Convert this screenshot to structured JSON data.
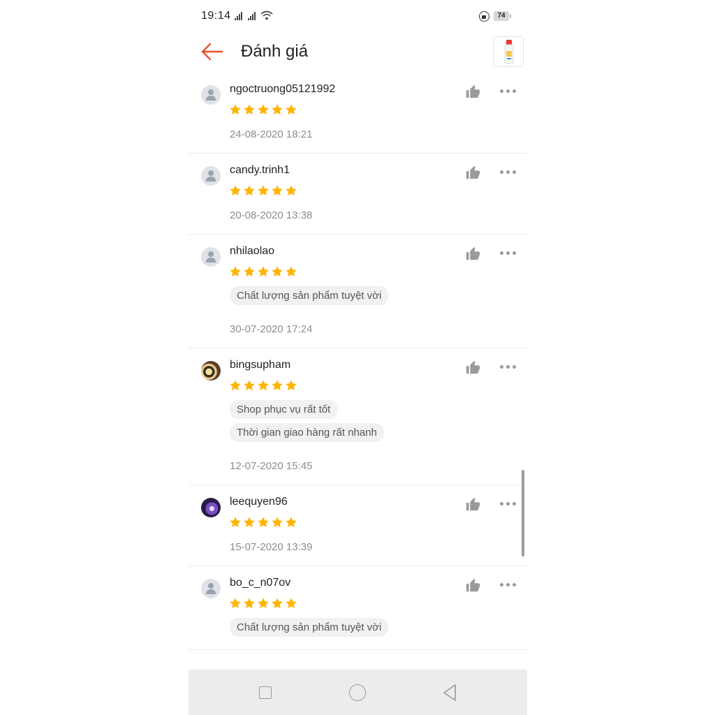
{
  "status": {
    "time": "19:14",
    "battery": "74"
  },
  "header": {
    "title": "Đánh giá"
  },
  "reviews": [
    {
      "user": "ngoctruong05121992",
      "rating": 5,
      "tags": [],
      "date": "24-08-2020 18:21",
      "avatar": "default"
    },
    {
      "user": "candy.trinh1",
      "rating": 5,
      "tags": [],
      "date": "20-08-2020 13:38",
      "avatar": "default"
    },
    {
      "user": "nhilaolao",
      "rating": 5,
      "tags": [
        "Chất lượng sản phẩm tuyệt vời"
      ],
      "date": "30-07-2020 17:24",
      "avatar": "default"
    },
    {
      "user": "bingsupham",
      "rating": 5,
      "tags": [
        "Shop phục vụ rất tốt",
        "Thời gian giao hàng rất nhanh"
      ],
      "date": "12-07-2020 15:45",
      "avatar": "photo1"
    },
    {
      "user": "leequyen96",
      "rating": 5,
      "tags": [],
      "date": "15-07-2020 13:39",
      "avatar": "photo2"
    },
    {
      "user": "bo_c_n07ov",
      "rating": 5,
      "tags": [
        "Chất lượng sản phẩm tuyệt vời"
      ],
      "date": "",
      "avatar": "default"
    }
  ],
  "colors": {
    "accent": "#ee4d2d",
    "star": "#ffb400",
    "icon_gray": "#9a9a9a"
  },
  "icons": {
    "back": "arrow-left-icon",
    "like": "thumbs-up-icon",
    "more": "more-horizontal-icon"
  }
}
